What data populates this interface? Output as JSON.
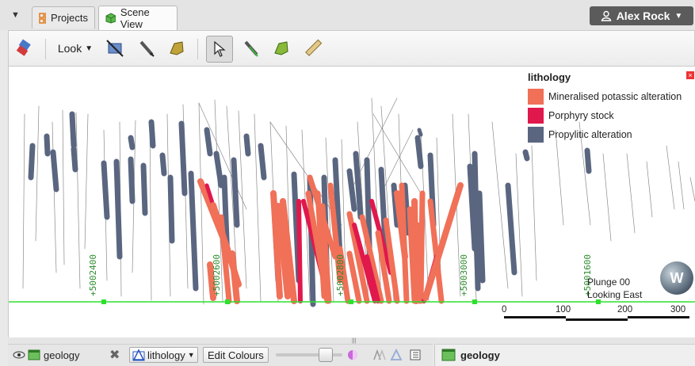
{
  "tabs": [
    {
      "label": "Projects",
      "icon": "projects-grid-icon"
    },
    {
      "label": "Scene View",
      "icon": "cube-icon"
    }
  ],
  "user": {
    "name": "Alex Rock"
  },
  "toolbar": {
    "look_label": "Look"
  },
  "legend": {
    "title": "lithology",
    "items": [
      {
        "label": "Mineralised potassic alteration",
        "color": "#f07058"
      },
      {
        "label": "Porphyry stock",
        "color": "#e0184c"
      },
      {
        "label": "Propylitic alteration",
        "color": "#5a6680"
      }
    ]
  },
  "grid_labels": [
    "+5002400",
    "+5002600",
    "+5002800",
    "+5003000",
    "+5001600"
  ],
  "view_info": {
    "plunge": "Plunge 00",
    "looking": "Looking East"
  },
  "scale_bar": {
    "ticks": [
      "0",
      "100",
      "200",
      "300"
    ]
  },
  "compass_letter": "W",
  "bottom": {
    "object_name": "geology",
    "colour_by": "lithology",
    "edit_colours": "Edit Colours",
    "right_panel_title": "geology"
  }
}
